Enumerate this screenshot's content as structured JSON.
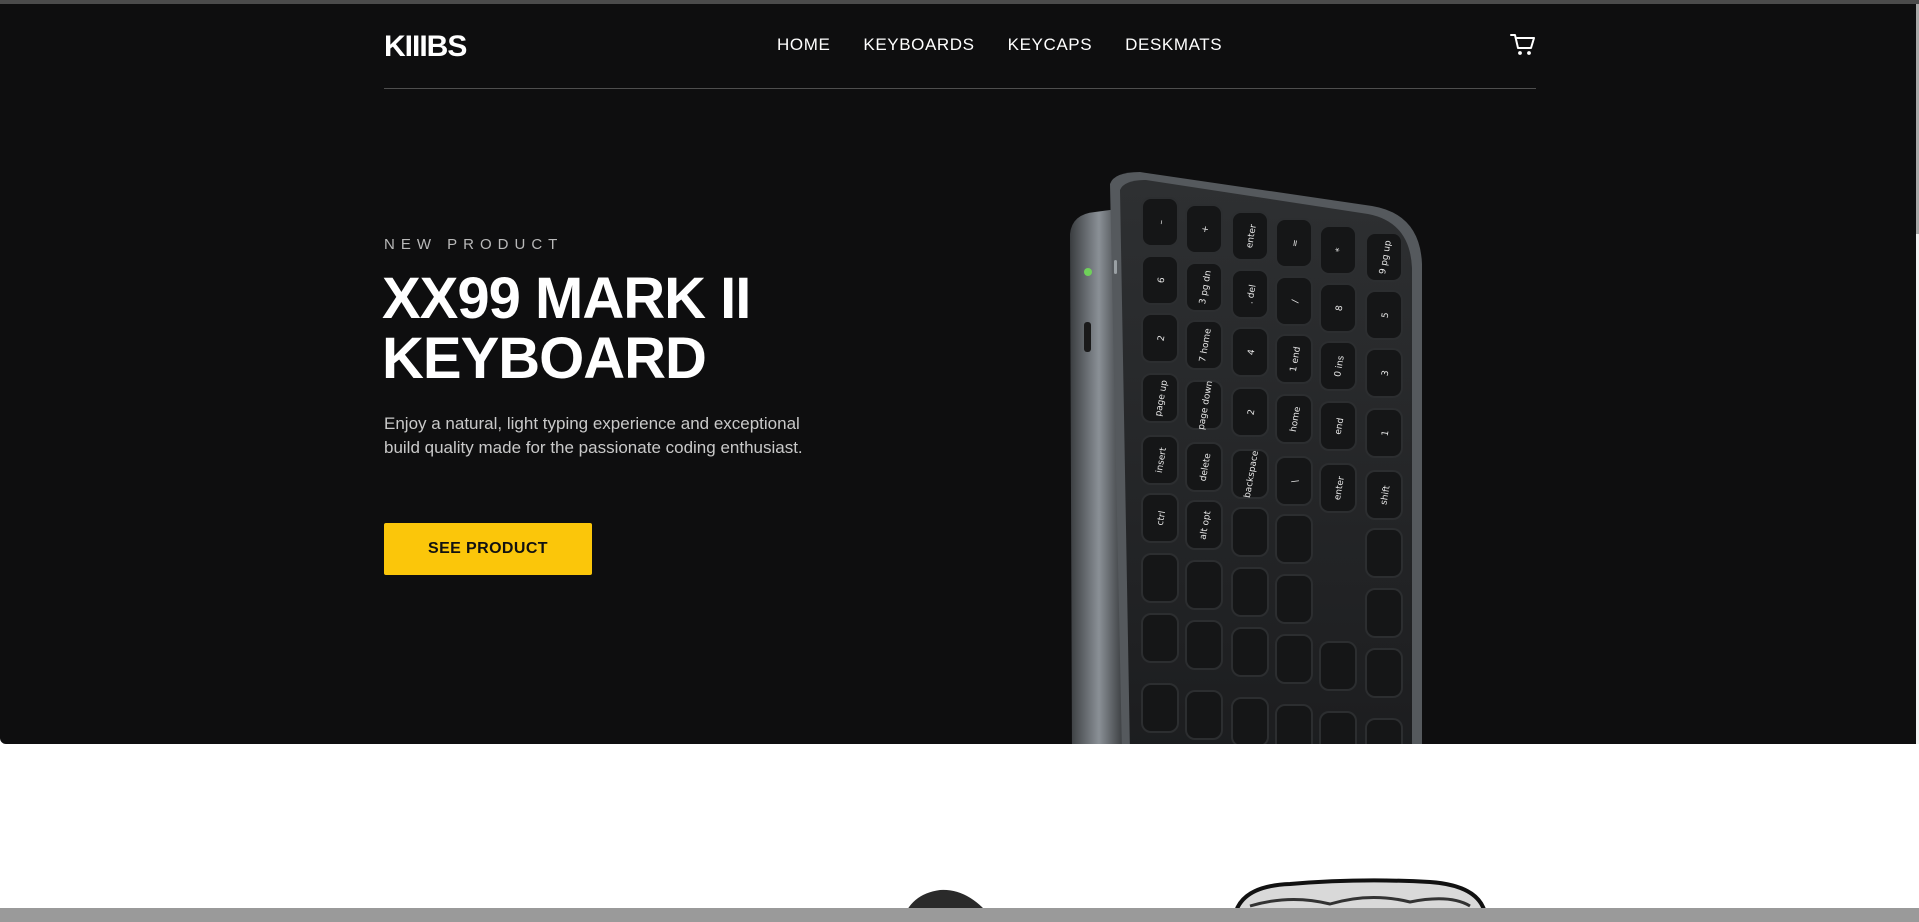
{
  "brand": {
    "logo": "KIIIBS"
  },
  "nav": {
    "items": [
      "HOME",
      "KEYBOARDS",
      "KEYCAPS",
      "DESKMATS"
    ]
  },
  "icons": {
    "cart": "cart-icon"
  },
  "hero": {
    "eyebrow": "NEW PRODUCT",
    "title": "XX99 MARK II KEYBOARD",
    "description": "Enjoy a natural, light typing experience and exceptional build quality made for the passionate coding enthusiast.",
    "cta_label": "SEE PRODUCT"
  },
  "keycaps": [
    "–",
    "+",
    "enter",
    "=",
    "*",
    "9 pg up",
    "6",
    "3 pg dn",
    ". del",
    "/",
    "8",
    "5",
    "2",
    "7 home",
    "4",
    "1 end",
    "0 ins",
    "3",
    "page up",
    "page down",
    "2",
    "home",
    "end",
    "1",
    "insert",
    "delete",
    "backspace",
    "\\",
    "enter",
    "shift",
    "ctrl",
    "alt opt"
  ],
  "colors": {
    "hero_bg": "#0e0e0f",
    "accent": "#fbc60a",
    "text": "#ffffff"
  }
}
